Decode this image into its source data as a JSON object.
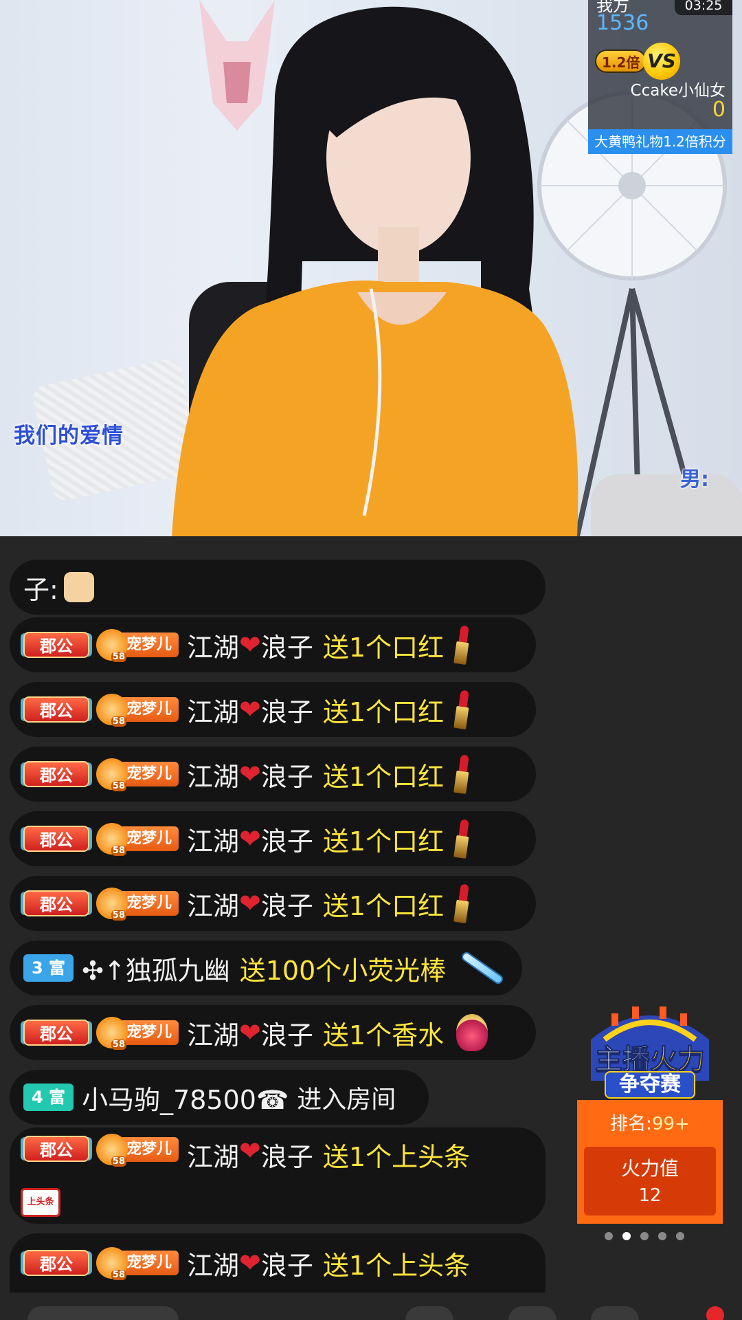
{
  "video": {
    "caption": "我们的爱情",
    "male_label": "男:"
  },
  "pk": {
    "timer": "03:25",
    "our_side_label": "我方",
    "our_score": "1536",
    "multiplier": "1.2倍",
    "vs_label": "VS",
    "opponent_name": "Ccake小仙女",
    "opponent_score": "0",
    "footer": "大黄鸭礼物1.2倍积分"
  },
  "chat": {
    "top_partial": "子:",
    "messages": [
      {
        "badge": "郡公",
        "fan_club": "宠梦儿",
        "fan_level": "58",
        "user_a": "江湖",
        "user_b": "浪子",
        "action": "送1个口红",
        "gift": "lipstick"
      },
      {
        "badge": "郡公",
        "fan_club": "宠梦儿",
        "fan_level": "58",
        "user_a": "江湖",
        "user_b": "浪子",
        "action": "送1个口红",
        "gift": "lipstick"
      },
      {
        "badge": "郡公",
        "fan_club": "宠梦儿",
        "fan_level": "58",
        "user_a": "江湖",
        "user_b": "浪子",
        "action": "送1个口红",
        "gift": "lipstick"
      },
      {
        "badge": "郡公",
        "fan_club": "宠梦儿",
        "fan_level": "58",
        "user_a": "江湖",
        "user_b": "浪子",
        "action": "送1个口红",
        "gift": "lipstick"
      },
      {
        "badge": "郡公",
        "fan_club": "宠梦儿",
        "fan_level": "58",
        "user_a": "江湖",
        "user_b": "浪子",
        "action": "送1个口红",
        "gift": "lipstick"
      },
      {
        "rich_badge": "3 富",
        "user": "✣↑独孤九幽",
        "action": "送100个小荧光棒",
        "gift": "glowstick"
      },
      {
        "badge": "郡公",
        "fan_club": "宠梦儿",
        "fan_level": "58",
        "user_a": "江湖",
        "user_b": "浪子",
        "action": "送1个香水",
        "gift": "perfume"
      },
      {
        "rich_badge": "4 富",
        "user": "小马驹_78500☎",
        "action": "进入房间"
      },
      {
        "badge": "郡公",
        "fan_club": "宠梦儿",
        "fan_level": "58",
        "user_a": "江湖",
        "user_b": "浪子",
        "action": "送1个上头条",
        "gift_label": "上头条"
      },
      {
        "badge": "郡公",
        "fan_club": "宠梦儿",
        "fan_level": "58",
        "user_a": "江湖",
        "user_b": "浪子",
        "action": "送1个上头条"
      }
    ]
  },
  "contest": {
    "title_part1": "主播",
    "title_part2": "火力",
    "subtitle": "争夺赛",
    "rank_label": "排名:",
    "rank_value": "99+",
    "fire_label": "火力值",
    "fire_value": "12",
    "pages": 5,
    "active_page": 2
  },
  "colors": {
    "chat_bg": "#262626",
    "bubble": "#141414",
    "action_text": "#ffe53b",
    "contest_orange": "#ff6a12",
    "pk_footer_blue": "#2b8ff0"
  }
}
